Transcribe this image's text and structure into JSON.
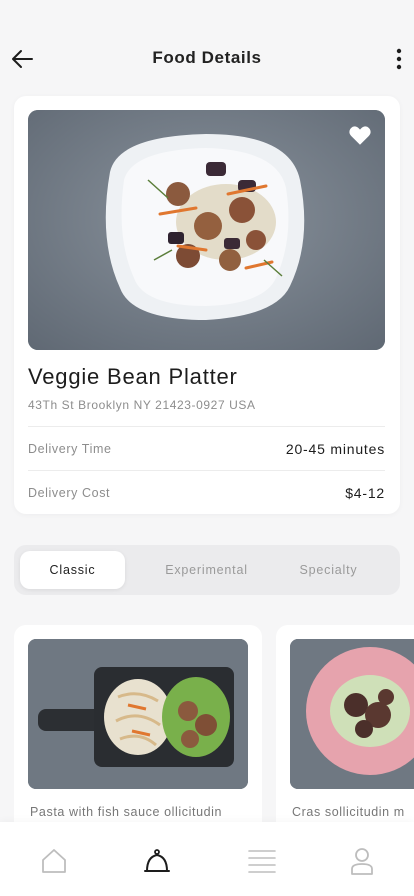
{
  "header": {
    "title": "Food Details"
  },
  "food": {
    "name": "Veggie Bean Platter",
    "address": "43Th St Brooklyn NY 21423-0927 USA",
    "favorite": true,
    "details": [
      {
        "label": "Delivery Time",
        "value": "20-45 minutes"
      },
      {
        "label": "Delivery Cost",
        "value": "$4-12"
      }
    ]
  },
  "tabs": [
    {
      "label": "Classic",
      "active": true
    },
    {
      "label": "Experimental",
      "active": false
    },
    {
      "label": "Specialty",
      "active": false
    }
  ],
  "products": [
    {
      "name": "Pasta with fish sauce ollicitudin"
    },
    {
      "name": "Cras sollicitudin m"
    }
  ],
  "bottom_nav": [
    {
      "icon": "home-icon",
      "active": false
    },
    {
      "icon": "bell-icon",
      "active": true
    },
    {
      "icon": "list-icon",
      "active": false
    },
    {
      "icon": "profile-icon",
      "active": false
    }
  ],
  "colors": {
    "background": "#f6f6f7",
    "card": "#ffffff",
    "text_primary": "#1d1d1d",
    "text_secondary": "#8d8d8d",
    "inactive_icon": "#bdbdbd"
  }
}
